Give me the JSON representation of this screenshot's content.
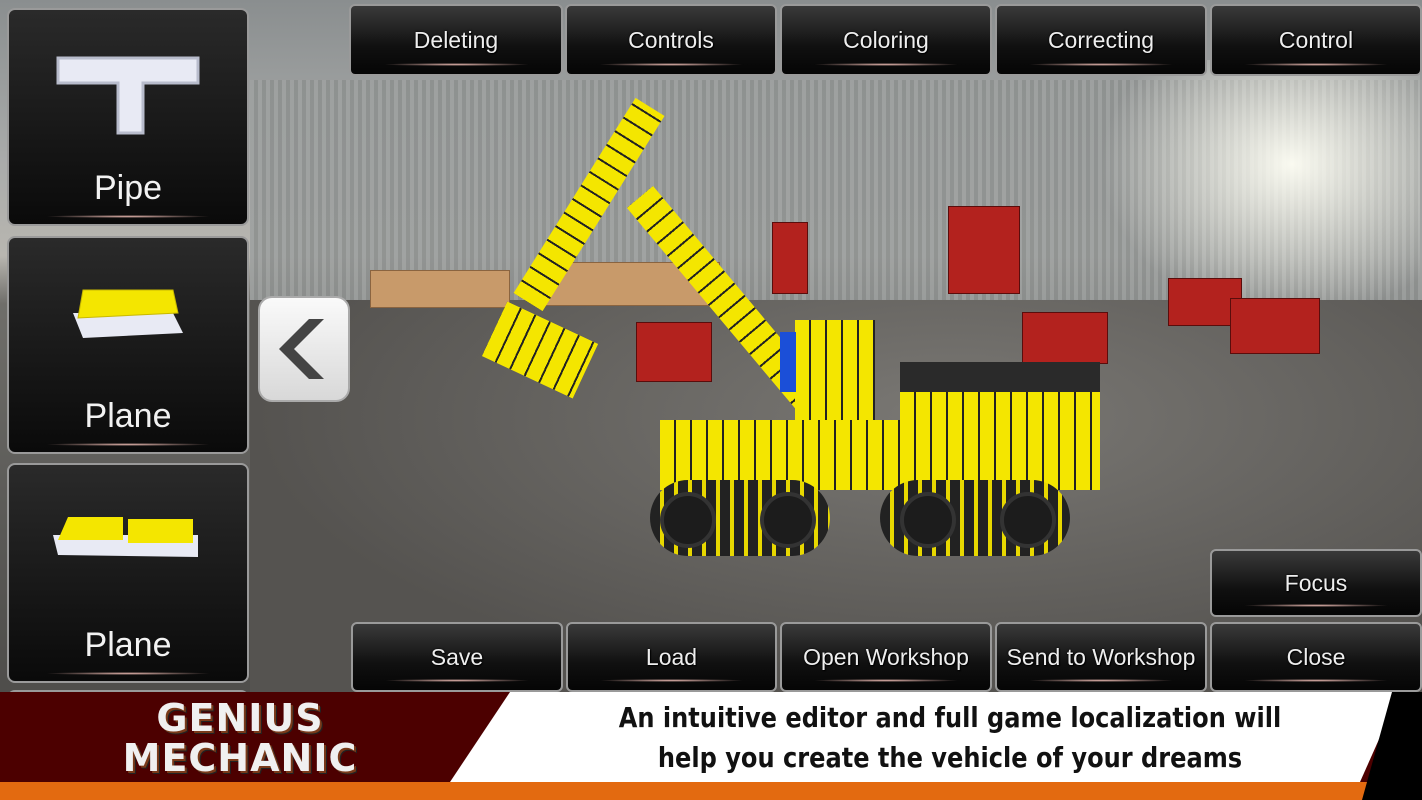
{
  "top_bar": [
    "Deleting",
    "Controls",
    "Coloring",
    "Correcting",
    "Control"
  ],
  "bottom_bar": [
    "Save",
    "Load",
    "Open Workshop",
    "Send to Workshop",
    "Close"
  ],
  "focus_label": "Focus",
  "parts": [
    {
      "label": "Pipe",
      "icon": "pipe-part-icon"
    },
    {
      "label": "Plane",
      "icon": "plane-part-icon"
    },
    {
      "label": "Plane",
      "icon": "double-plane-part-icon"
    }
  ],
  "banner": {
    "logo": "GENIUS MECHANIC",
    "tagline_line1": "An intuitive editor and full game localization will",
    "tagline_line2": "help you create the vehicle of your dreams"
  },
  "colors": {
    "part_yellow": "#f4e600",
    "banner_red": "#4c0000",
    "banner_orange": "#e36a10"
  }
}
